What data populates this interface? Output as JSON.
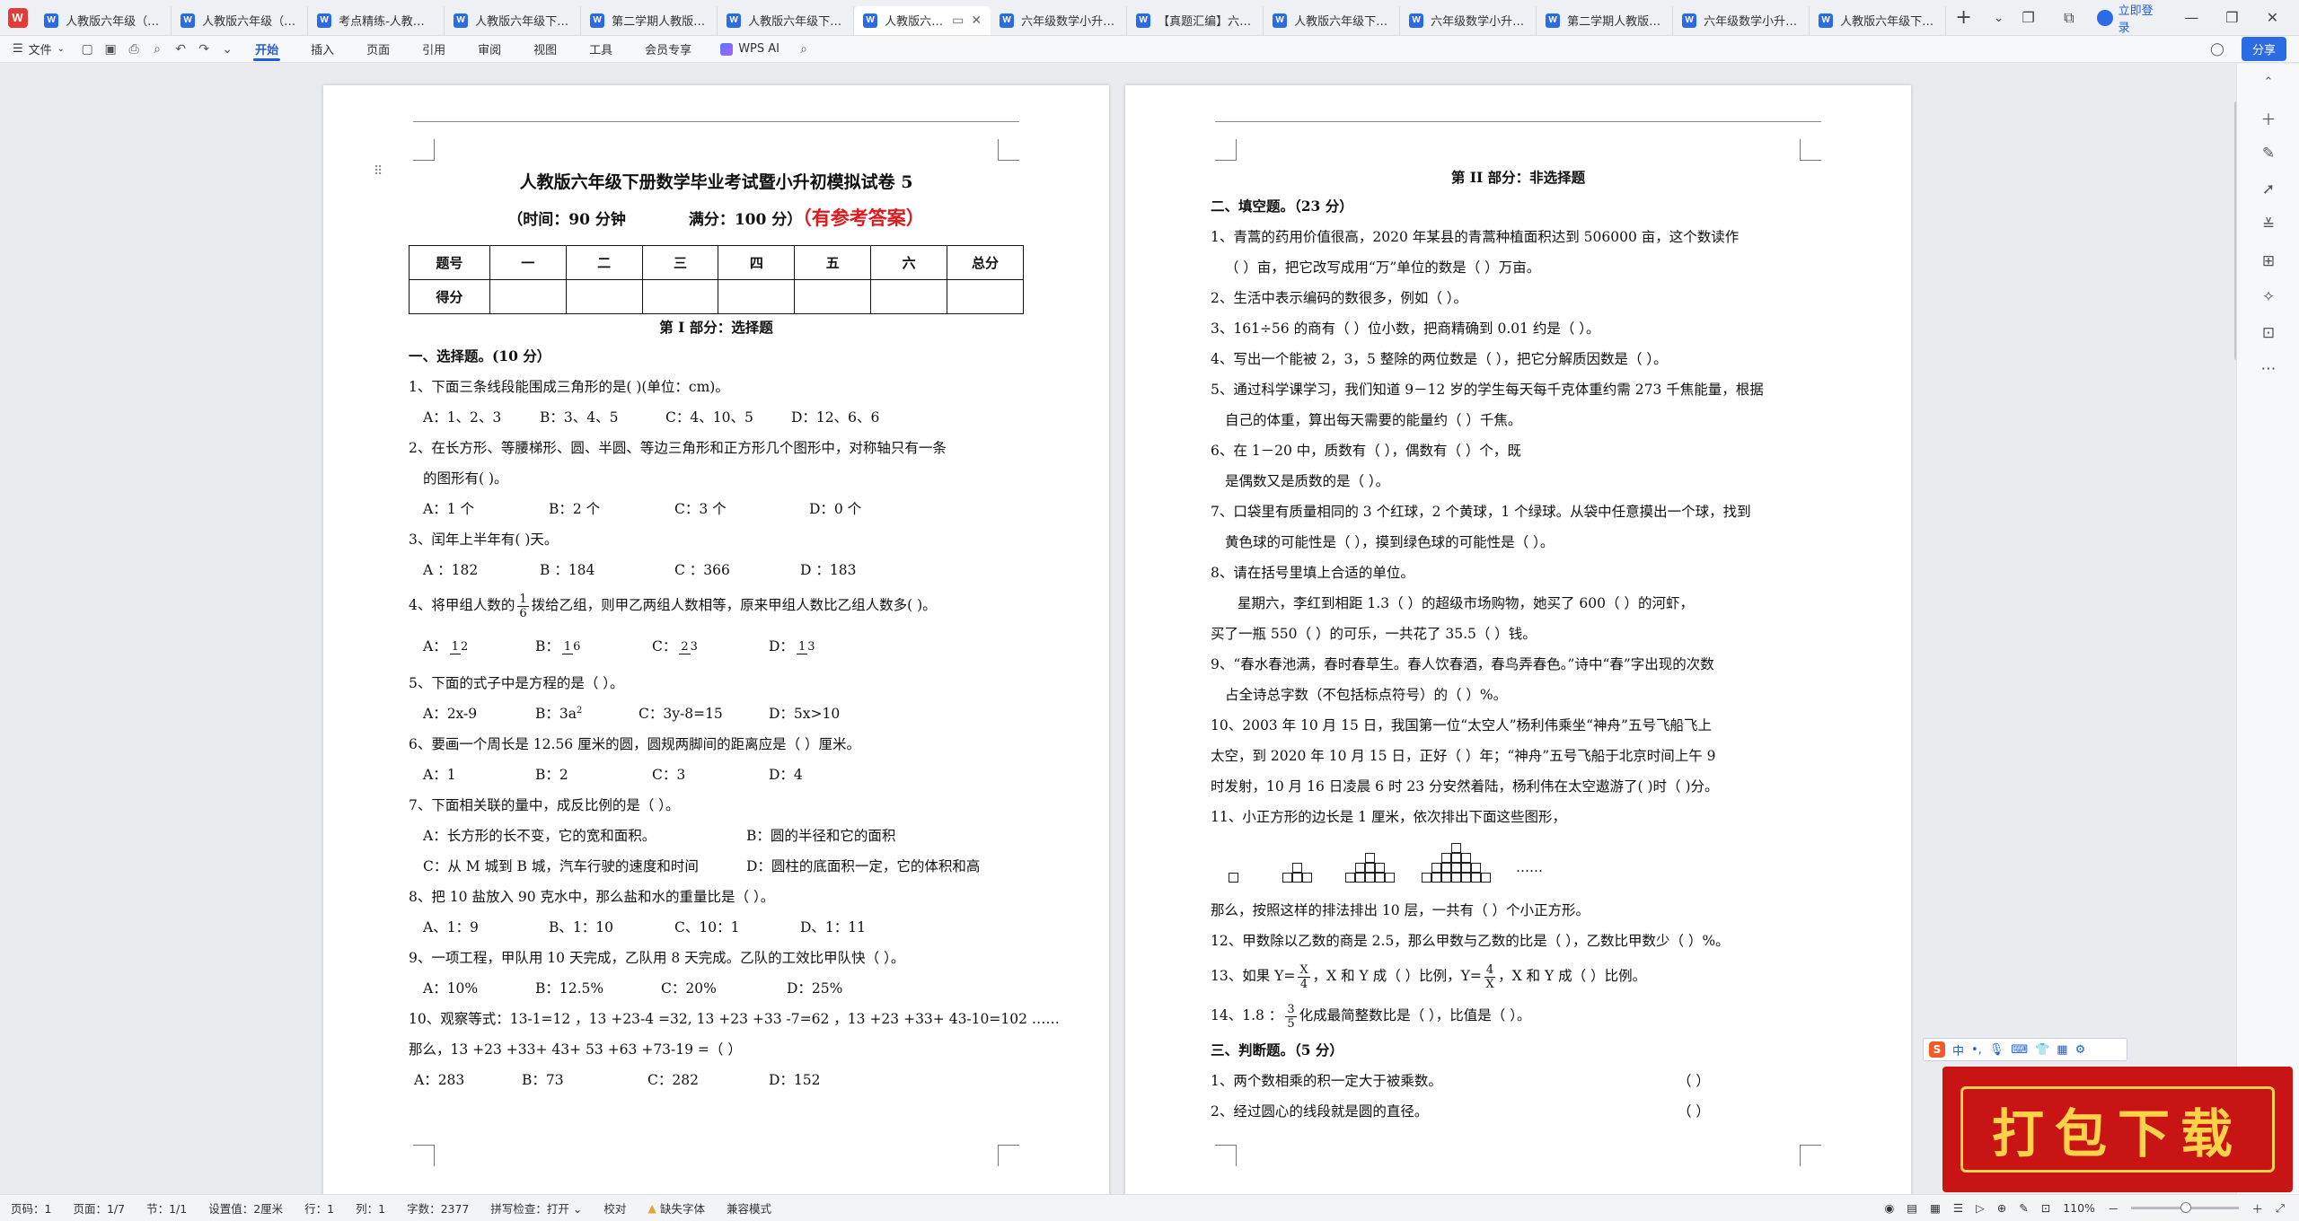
{
  "tabs": [
    {
      "label": "人教版六年级（小升"
    },
    {
      "label": "人教版六年级（小升"
    },
    {
      "label": "考点精练-人教版六年"
    },
    {
      "label": "人教版六年级下册数"
    },
    {
      "label": "第二学期人教版小升"
    },
    {
      "label": "人教版六年级下册数"
    },
    {
      "label": "人教版六年级",
      "active": true
    },
    {
      "label": "六年级数学小升初考"
    },
    {
      "label": "【真题汇编】六年级"
    },
    {
      "label": "人教版六年级下册数"
    },
    {
      "label": "六年级数学小升初考"
    },
    {
      "label": "第二学期人教版小升"
    },
    {
      "label": "六年级数学小升初考"
    },
    {
      "label": "人教版六年级下册数"
    }
  ],
  "titlebar": {
    "login": "立即登录"
  },
  "menubar": {
    "file": "文件",
    "items": [
      "开始",
      "插入",
      "页面",
      "引用",
      "审阅",
      "视图",
      "工具",
      "会员专享"
    ],
    "wps_ai": "WPS AI",
    "share": "分享"
  },
  "page1": {
    "title": "人教版六年级下册数学毕业考试暨小升初模拟试卷 5",
    "time": "（时间：90 分钟",
    "full": "满分：100 分）",
    "answer_note": "（有参考答案）",
    "table_header": [
      "题号",
      "一",
      "二",
      "三",
      "四",
      "五",
      "六",
      "总分"
    ],
    "table_row2": [
      "得分",
      "",
      "",
      "",
      "",
      "",
      "",
      ""
    ],
    "part1": "第 I 部分：选择题",
    "section1": "一、选择题。(10 分）",
    "q1": "1、下面三条线段能围成三角形的是(        )(单位：cm)。",
    "q1_opts": [
      "A：1、2、3",
      "B：3、4、5",
      "C：4、10、5",
      "D：12、6、6"
    ],
    "q2a": "2、在长方形、等腰梯形、圆、半圆、等边三角形和正方形几个图形中，对称轴只有一条",
    "q2b": "的图形有(      )。",
    "q2_opts": [
      "A：1 个",
      "B：2 个",
      "C：3 个",
      "D：0 个"
    ],
    "q3": "3、闰年上半年有(      )天。",
    "q3_opts": [
      "A ：182",
      "B ：184",
      "C ：366",
      "D ：183"
    ],
    "q4_pre": "4、将甲组人数的",
    "q4_post": "拨给乙组，则甲乙两组人数相等，原来甲组人数比乙组人数多(      )。",
    "q4_frac": {
      "n": "1",
      "d": "6"
    },
    "q4_opts": [
      {
        "l": "A：",
        "n": "1",
        "d": "2"
      },
      {
        "l": "B：",
        "n": "1",
        "d": "6"
      },
      {
        "l": "C：",
        "n": "2",
        "d": "3"
      },
      {
        "l": "D：",
        "n": "1",
        "d": "3"
      }
    ],
    "q5": "5、下面的式子中是方程的是（              ）。",
    "q5_opts": [
      "A：2x-9",
      "B：3a",
      "C：3y-8=15",
      "D：5x>10"
    ],
    "q5_sup": "2",
    "q6": "6、要画一个周长是 12.56 厘米的圆，圆规两脚间的距离应是（      ）厘米。",
    "q6_opts": [
      "A：1",
      "B：2",
      "C：3",
      "D：4"
    ],
    "q7": "7、下面相关联的量中，成反比例的是（              ）。",
    "q7_opts1": [
      "A：长方形的长不变，它的宽和面积。",
      "B：圆的半径和它的面积"
    ],
    "q7_opts2": [
      "C：从 M 城到 B 城，汽车行驶的速度和时间",
      "D：圆柱的底面积一定，它的体积和高"
    ],
    "q8": "8、把 10 盐放入 90 克水中，那么盐和水的重量比是（        ）。",
    "q8_opts": [
      "A、1：9",
      "B、1：10",
      "C、10：1",
      "D、1：11"
    ],
    "q9": "9、一项工程，甲队用 10 天完成，乙队用 8 天完成。乙队的工效比甲队快（      ）。",
    "q9_opts": [
      "A：10%",
      "B：12.5%",
      "C：20%",
      "D：25%"
    ],
    "q10a": "10、观察等式：13-1=12 ，13 +23-4 =32, 13 +23 +33 -7=62 ，13 +23 +33+ 43-10=102 ……",
    "q10b": "那么，13 +23 +33+ 43+ 53 +63 +73-19 =（      ）",
    "q10_opts": [
      "A：283",
      "B：73",
      "C：282",
      "D：152"
    ]
  },
  "page2": {
    "part2": "第 II 部分：非选择题",
    "section2": "二、填空题。（23 分）",
    "l1": "1、青蒿的药用价值很高，2020 年某县的青蒿种植面积达到 506000 亩，这个数读作",
    "l2": "（                        ）亩，把它改写成用“万”单位的数是（              ）万亩。",
    "l3": "2、生活中表示编码的数很多，例如（                                ）。",
    "l4": "3、161÷56 的商有（      ）位小数，把商精确到 0.01 约是（              ）。",
    "l5": "4、写出一个能被 2，3，5 整除的两位数是（      ），把它分解质因数是（                ）。",
    "l6": "5、通过科学课学习，我们知道 9－12 岁的学生每天每千克体重约需 273 千焦能量，根据",
    "l7": "自己的体重，算出每天需要的能量约（            ）千焦。",
    "l8": "6、在 1－20 中，质数有（                                    ），偶数有（          ）个，既",
    "l9": "是偶数又是质数的是（            ）。",
    "l10": "7、口袋里有质量相同的 3 个红球，2 个黄球，1 个绿球。从袋中任意摸出一个球，找到",
    "l11": "黄色球的可能性是（            ），摸到绿色球的可能性是（            ）。",
    "l12": "8、请在括号里填上合适的单位。",
    "l13": "星期六，李红到相距 1.3（          ）的超级市场购物，她买了 600（      ）的河虾，",
    "l14": "买了一瓶 550（      ）的可乐，一共花了 35.5（        ）钱。",
    "l15": "9、“春水春池满，春时春草生。春人饮春酒，春鸟弄春色。”诗中“春”字出现的次数",
    "l16": "占全诗总字数（不包括标点符号）的（          ）%。",
    "l17": "10、2003 年 10 月 15 日，我国第一位“太空人”杨利伟乘坐“神舟”五号飞船飞上",
    "l18": "太空，到 2020 年 10 月 15 日，正好（          ）年；“神舟”五号飞船于北京时间上午 9",
    "l19": "时发射，10 月 16 日凌晨 6 时 23 分安然着陆，杨利伟在太空遨游了(      )时（      )分。",
    "l20": "11、小正方形的边长是 1 厘米，依次排出下面这些图形，",
    "dots": "……",
    "l21": "那么，按照这样的排法排出 10 层，一共有（          ）个小正方形。",
    "l22": "12、甲数除以乙数的商是 2.5，那么甲数与乙数的比是（      ），乙数比甲数少（      ）%。",
    "l23_a": "13、如果 Y=",
    "l23_f1": {
      "n": "X",
      "d": "4"
    },
    "l23_b": "，X 和 Y 成（      ）比例，Y=",
    "l23_f2": {
      "n": "4",
      "d": "X"
    },
    "l23_c": "，X 和 Y 成（      ）比例。",
    "l24_a": "14、1.8 ：",
    "l24_f": {
      "n": "3",
      "d": "5"
    },
    "l24_b": "化成最简整数比是（      ），比值是（      ）。",
    "section3": "三、判断题。（5 分）",
    "j1": "1、两个数相乘的积一定大于被乘数。",
    "j1_p": "（        ）",
    "j2": "2、经过圆心的线段就是圆的直径。",
    "j2_p": "（        ）"
  },
  "ime": {
    "mode": "中"
  },
  "download_badge": "打包下载",
  "statusbar": {
    "page_code": "页码：1",
    "page": "页面：1/7",
    "section": "节：1/1",
    "setting": "设置值：2厘米",
    "row": "行：1",
    "col": "列：1",
    "words": "字数：2377",
    "spell": "拼写检查：打开",
    "proof": "校对",
    "missing_font": "缺失字体",
    "compat": "兼容模式",
    "zoom": "110%"
  }
}
